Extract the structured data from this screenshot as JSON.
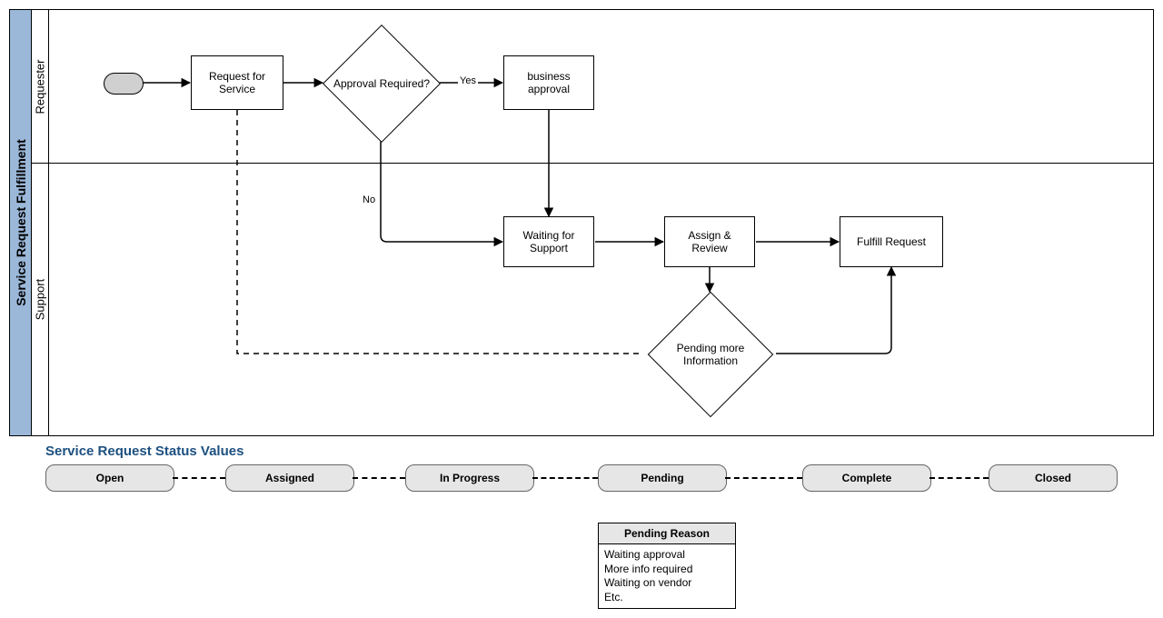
{
  "pool": {
    "title": "Service Request Fulfillment"
  },
  "lanes": {
    "requester": "Requester",
    "support": "Support"
  },
  "nodes": {
    "request_for_service": "Request for Service",
    "approval_required": "Approval Required?",
    "business_approval": "business approval",
    "waiting_for_support": "Waiting for Support",
    "assign_review": "Assign & Review",
    "fulfill_request": "Fulfill Request",
    "pending_more_info": "Pending more Information"
  },
  "edge_labels": {
    "yes": "Yes",
    "no": "No"
  },
  "status_section": {
    "title": "Service Request Status Values",
    "values": [
      "Open",
      "Assigned",
      "In Progress",
      "Pending",
      "Complete",
      "Closed"
    ]
  },
  "pending_reason": {
    "title": "Pending Reason",
    "items": [
      "Waiting approval",
      "More info required",
      "Waiting on vendor",
      "Etc."
    ]
  }
}
